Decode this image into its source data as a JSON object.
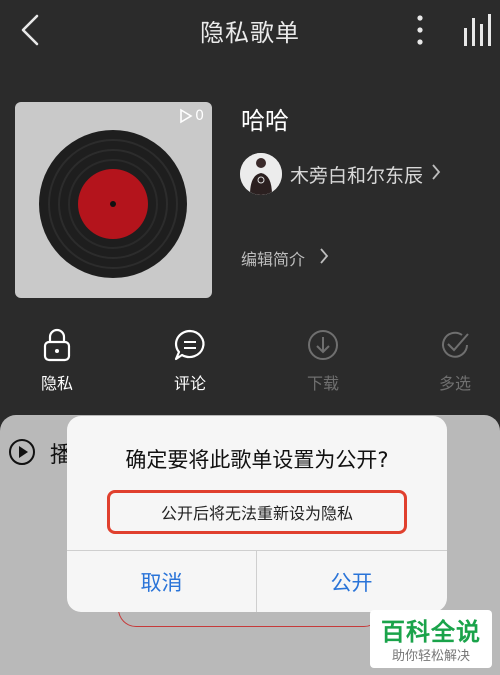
{
  "header": {
    "title": "隐私歌单"
  },
  "playlist": {
    "name": "哈哈",
    "play_count": "0",
    "creator": "木旁白和尔东辰",
    "edit_intro": "编辑简介"
  },
  "actions": [
    {
      "label": "隐私",
      "icon": "lock-icon"
    },
    {
      "label": "评论",
      "icon": "comment-icon"
    },
    {
      "label": "下载",
      "icon": "download-icon"
    },
    {
      "label": "多选",
      "icon": "multi-select-icon"
    }
  ],
  "play_all": {
    "label": "播"
  },
  "dialog": {
    "title": "确定要将此歌单设置为公开?",
    "message": "公开后将无法重新设为隐私",
    "cancel": "取消",
    "confirm": "公开"
  },
  "watermark": {
    "title": "百科全说",
    "subtitle": "助你轻松解决"
  },
  "colors": {
    "header_bg": "#2b2b2b",
    "dialog_button": "#2a74d8",
    "highlight_border": "#e0402e",
    "watermark_green": "#1aa34a"
  }
}
